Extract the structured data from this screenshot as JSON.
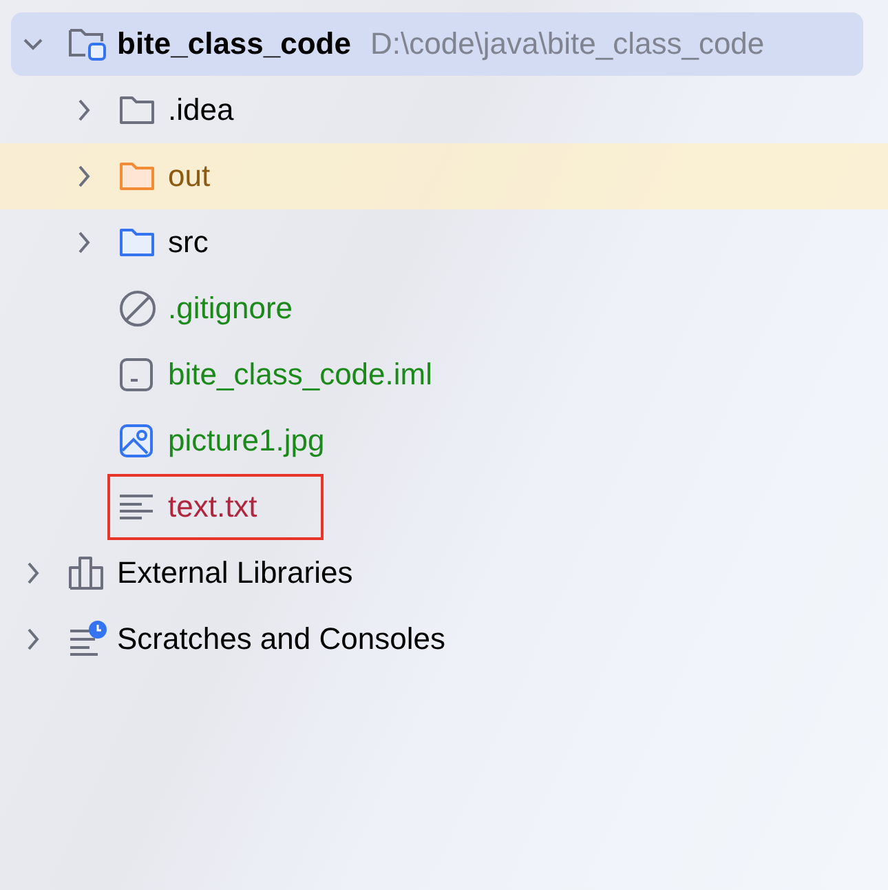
{
  "tree": [
    {
      "label": "bite_class_code",
      "path": "D:\\code\\java\\bite_class_code",
      "kind": "module",
      "expanded": true,
      "selected": true,
      "excluded": false,
      "marked": false,
      "color": "#000000",
      "children": [
        {
          "label": ".idea",
          "kind": "folder",
          "expanded": false,
          "selected": false,
          "excluded": false,
          "marked": false,
          "color": "#000000"
        },
        {
          "label": "out",
          "kind": "folder-excluded",
          "expanded": false,
          "selected": false,
          "excluded": true,
          "marked": false,
          "color": "#8c5a10"
        },
        {
          "label": "src",
          "kind": "folder-source",
          "expanded": false,
          "selected": false,
          "excluded": false,
          "marked": false,
          "color": "#000000"
        },
        {
          "label": ".gitignore",
          "kind": "ignore",
          "selected": false,
          "excluded": false,
          "marked": false,
          "color": "#1b8a1b"
        },
        {
          "label": "bite_class_code.iml",
          "kind": "iml",
          "selected": false,
          "excluded": false,
          "marked": false,
          "color": "#1b8a1b"
        },
        {
          "label": "picture1.jpg",
          "kind": "image",
          "selected": false,
          "excluded": false,
          "marked": false,
          "color": "#1b8a1b"
        },
        {
          "label": "text.txt",
          "kind": "text",
          "selected": false,
          "excluded": false,
          "marked": true,
          "color": "#b0263e"
        }
      ]
    },
    {
      "label": "External Libraries",
      "kind": "libraries",
      "expanded": false,
      "selected": false,
      "excluded": false,
      "marked": false,
      "color": "#000000"
    },
    {
      "label": "Scratches and Consoles",
      "kind": "scratches",
      "expanded": false,
      "selected": false,
      "excluded": false,
      "marked": false,
      "color": "#000000"
    }
  ]
}
